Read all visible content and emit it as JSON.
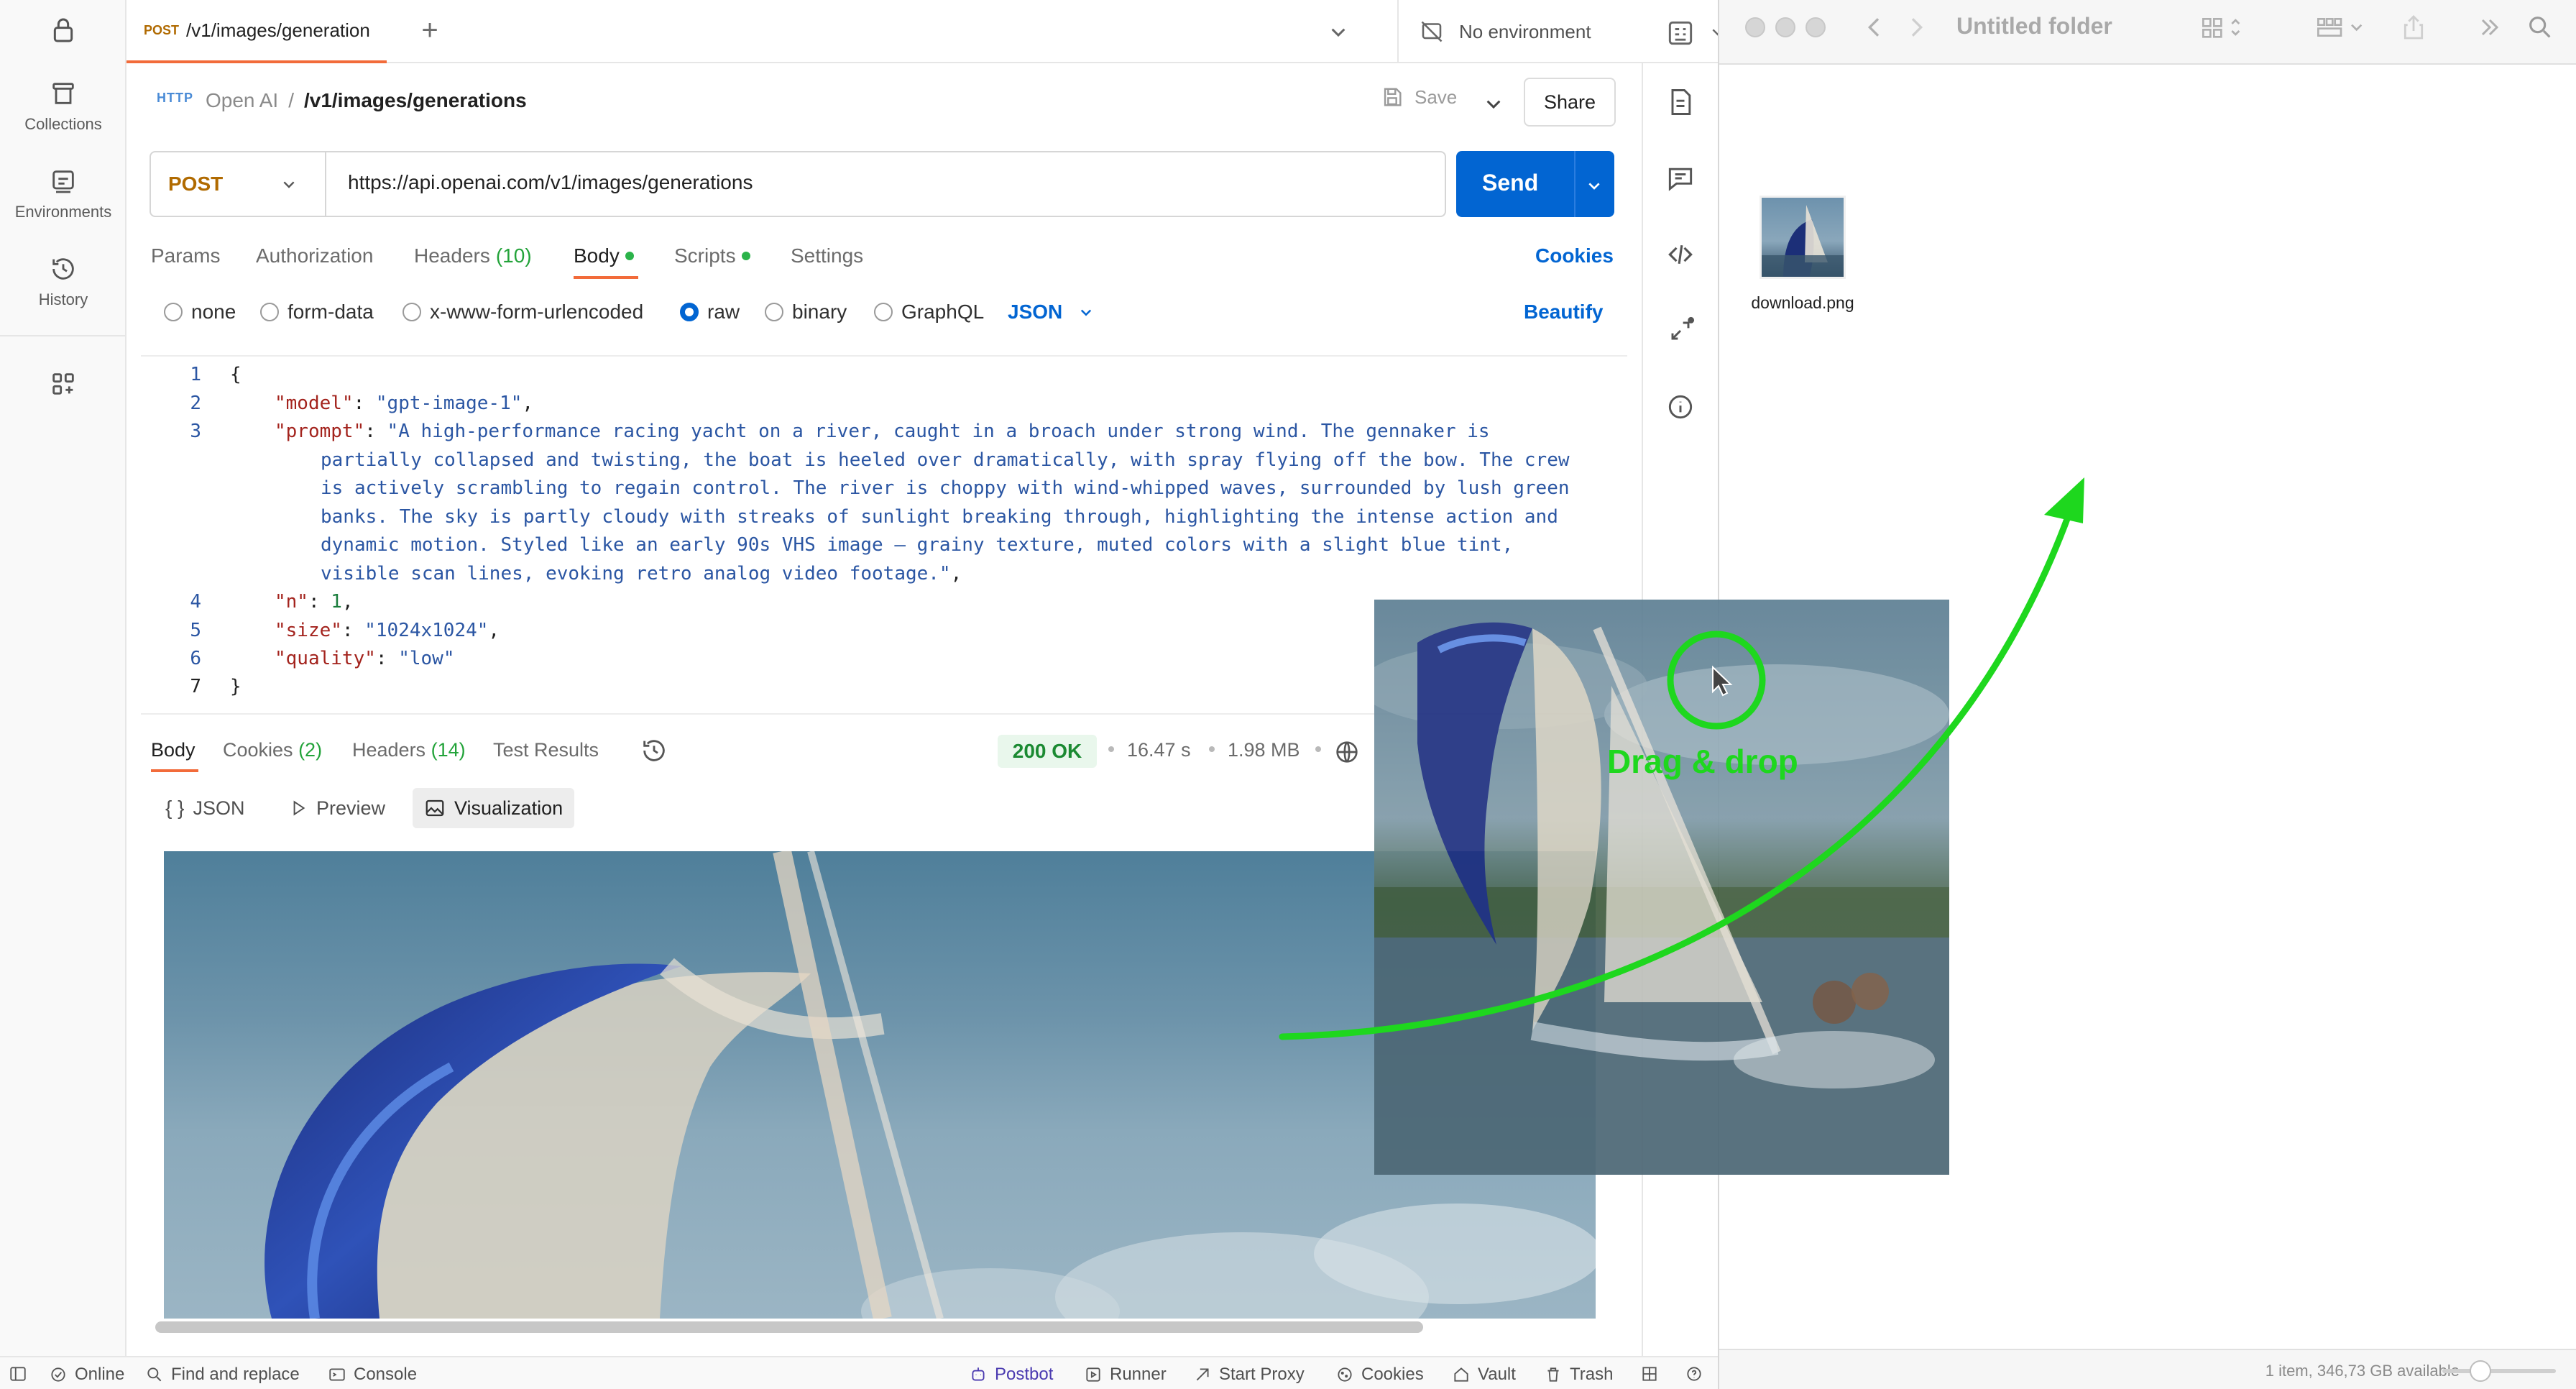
{
  "sidebar": {
    "items": [
      {
        "label": "Collections",
        "icon": "trash-can-icon"
      },
      {
        "label": "Environments",
        "icon": "environment-icon"
      },
      {
        "label": "History",
        "icon": "history-icon"
      }
    ]
  },
  "tab": {
    "method": "POST",
    "title": "/v1/images/generation"
  },
  "environment": {
    "label": "No environment"
  },
  "request": {
    "protocol_badge": "HTTP",
    "breadcrumb_parent": "Open AI",
    "breadcrumb_sep": "/",
    "breadcrumb_current": "/v1/images/generations",
    "save_label": "Save",
    "share_label": "Share",
    "method": "POST",
    "url": "https://api.openai.com/v1/images/generations",
    "send_label": "Send"
  },
  "request_tabs": {
    "params": "Params",
    "authorization": "Authorization",
    "headers": "Headers",
    "headers_count": "(10)",
    "body": "Body",
    "scripts": "Scripts",
    "settings": "Settings",
    "cookies": "Cookies"
  },
  "body_types": {
    "none": "none",
    "form_data": "form-data",
    "urlencoded": "x-www-form-urlencoded",
    "raw": "raw",
    "binary": "binary",
    "graphql": "GraphQL",
    "language": "JSON",
    "beautify": "Beautify"
  },
  "editor": {
    "line_numbers": [
      "1",
      "2",
      "3",
      "4",
      "5",
      "6",
      "7"
    ],
    "l1": "{",
    "l2_key": "\"model\"",
    "l2_val": "\"gpt-image-1\"",
    "l3_key": "\"prompt\"",
    "l3_val_1": "\"A high-performance racing yacht on a river, caught in a broach under strong wind. The gennaker is",
    "l3_val_2": "partially collapsed and twisting, the boat is heeled over dramatically, with spray flying off the bow. The crew",
    "l3_val_3": "is actively scrambling to regain control. The river is choppy with wind-whipped waves, surrounded by lush green",
    "l3_val_4": "banks. The sky is partly cloudy with streaks of sunlight breaking through, highlighting the intense action and",
    "l3_val_5": "dynamic motion. Styled like an early 90s VHS image — grainy texture, muted colors with a slight blue tint,",
    "l3_val_6": "visible scan lines, evoking retro analog video footage.\"",
    "l4_key": "\"n\"",
    "l4_val": "1",
    "l5_key": "\"size\"",
    "l5_val": "\"1024x1024\"",
    "l6_key": "\"quality\"",
    "l6_val": "\"low\"",
    "l7": "}"
  },
  "response": {
    "tabs": {
      "body": "Body",
      "cookies": "Cookies",
      "cookies_count": "(2)",
      "headers": "Headers",
      "headers_count": "(14)",
      "tests": "Test Results"
    },
    "status": "200 OK",
    "time": "16.47 s",
    "size": "1.98 MB",
    "views": {
      "json": "JSON",
      "preview": "Preview",
      "visualization": "Visualization"
    }
  },
  "statusbar": {
    "online": "Online",
    "find": "Find and replace",
    "console": "Console",
    "postbot": "Postbot",
    "runner": "Runner",
    "proxy": "Start Proxy",
    "cookies": "Cookies",
    "vault": "Vault",
    "trash": "Trash"
  },
  "finder": {
    "title": "Untitled folder",
    "file_name": "download.png",
    "status": "1 item, 346,73 GB available"
  },
  "overlay": {
    "drag_label": "Drag & drop"
  },
  "colors": {
    "accent": "#0265d2",
    "tab_underline": "#f26b3a",
    "method_post": "#b06a00",
    "success": "#1b8a32",
    "annotation": "#1ed71e"
  }
}
